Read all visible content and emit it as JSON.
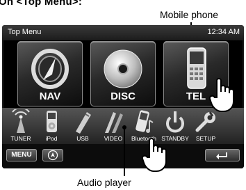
{
  "page": {
    "intro": "On <Top Menu>:"
  },
  "callouts": {
    "mobile_phone": "Mobile phone",
    "audio_player": "Audio player"
  },
  "screen": {
    "title": "Top Menu",
    "clock": "12:34 AM",
    "main_buttons": [
      {
        "label": "NAV",
        "icon": "nav-icon"
      },
      {
        "label": "DISC",
        "icon": "disc-icon"
      },
      {
        "label": "TEL",
        "icon": "mobile-phone-icon"
      }
    ],
    "sources": [
      {
        "label": "TUNER",
        "icon": "antenna-icon"
      },
      {
        "label": "iPod",
        "icon": "ipod-icon"
      },
      {
        "label": "USB",
        "icon": "usb-icon"
      },
      {
        "label": "VIDEO",
        "icon": "video-icon"
      },
      {
        "label": "Bluetooth",
        "icon": "audio-player-icon"
      },
      {
        "label": "STANDBY",
        "icon": "standby-icon"
      },
      {
        "label": "SETUP",
        "icon": "setup-icon"
      }
    ],
    "bottom": {
      "menu": "MENU",
      "compass_icon": "compass-icon",
      "back_icon": "back-icon"
    }
  }
}
